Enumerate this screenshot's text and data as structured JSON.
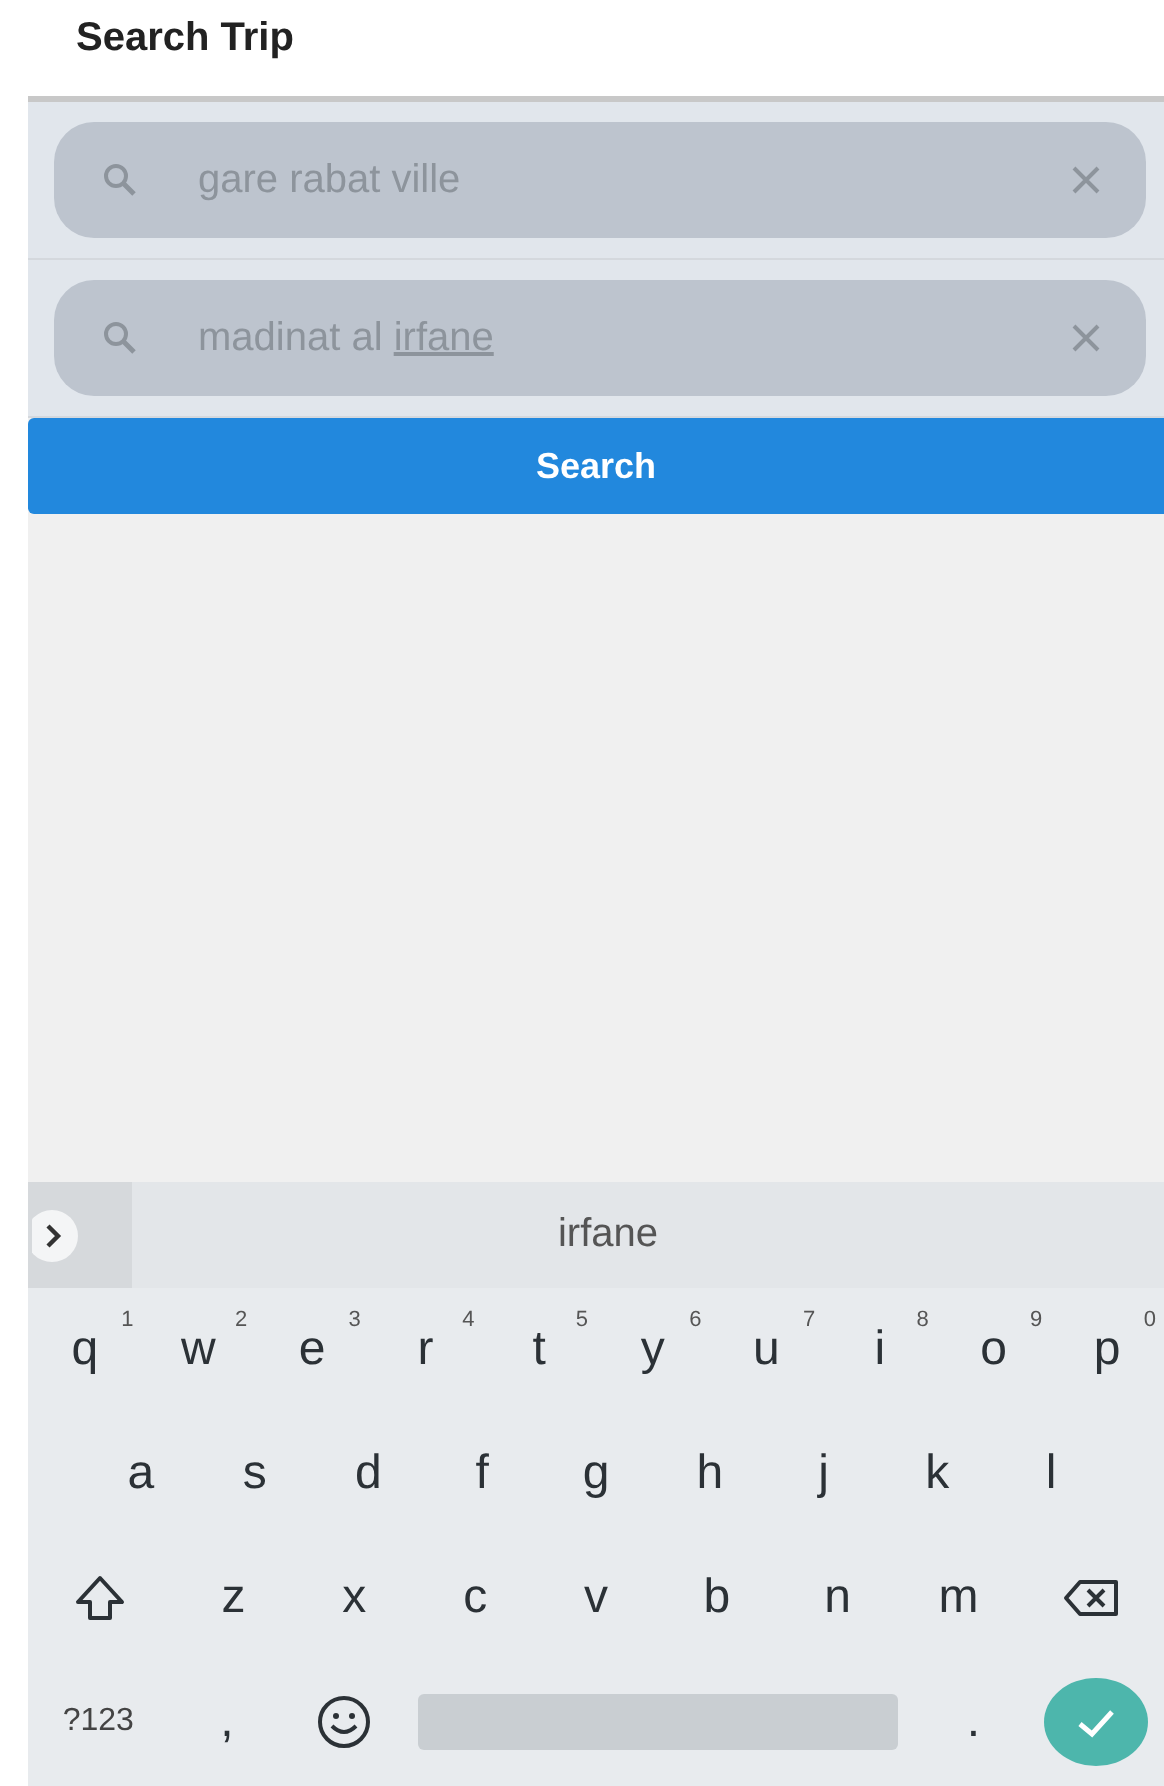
{
  "header": {
    "title": "Search Trip"
  },
  "fields": [
    {
      "value": "gare rabat ville"
    },
    {
      "value": "madinat al ",
      "composing": "irfane"
    }
  ],
  "search_button": {
    "label": "Search"
  },
  "keyboard": {
    "suggestion": "irfane",
    "rows": [
      [
        {
          "kind": "letter",
          "label": "q",
          "hint": "1"
        },
        {
          "kind": "letter",
          "label": "w",
          "hint": "2"
        },
        {
          "kind": "letter",
          "label": "e",
          "hint": "3"
        },
        {
          "kind": "letter",
          "label": "r",
          "hint": "4"
        },
        {
          "kind": "letter",
          "label": "t",
          "hint": "5"
        },
        {
          "kind": "letter",
          "label": "y",
          "hint": "6"
        },
        {
          "kind": "letter",
          "label": "u",
          "hint": "7"
        },
        {
          "kind": "letter",
          "label": "i",
          "hint": "8"
        },
        {
          "kind": "letter",
          "label": "o",
          "hint": "9"
        },
        {
          "kind": "letter",
          "label": "p",
          "hint": "0"
        }
      ],
      [
        {
          "kind": "letter",
          "label": "a"
        },
        {
          "kind": "letter",
          "label": "s"
        },
        {
          "kind": "letter",
          "label": "d"
        },
        {
          "kind": "letter",
          "label": "f"
        },
        {
          "kind": "letter",
          "label": "g"
        },
        {
          "kind": "letter",
          "label": "h"
        },
        {
          "kind": "letter",
          "label": "j"
        },
        {
          "kind": "letter",
          "label": "k"
        },
        {
          "kind": "letter",
          "label": "l"
        }
      ],
      [
        {
          "kind": "shift"
        },
        {
          "kind": "letter",
          "label": "z"
        },
        {
          "kind": "letter",
          "label": "x"
        },
        {
          "kind": "letter",
          "label": "c"
        },
        {
          "kind": "letter",
          "label": "v"
        },
        {
          "kind": "letter",
          "label": "b"
        },
        {
          "kind": "letter",
          "label": "n"
        },
        {
          "kind": "letter",
          "label": "m"
        },
        {
          "kind": "backspace"
        }
      ],
      [
        {
          "kind": "symbols",
          "label": "?123"
        },
        {
          "kind": "letter",
          "label": ","
        },
        {
          "kind": "emoji"
        },
        {
          "kind": "space"
        },
        {
          "kind": "letter",
          "label": "."
        },
        {
          "kind": "enter"
        }
      ]
    ]
  }
}
